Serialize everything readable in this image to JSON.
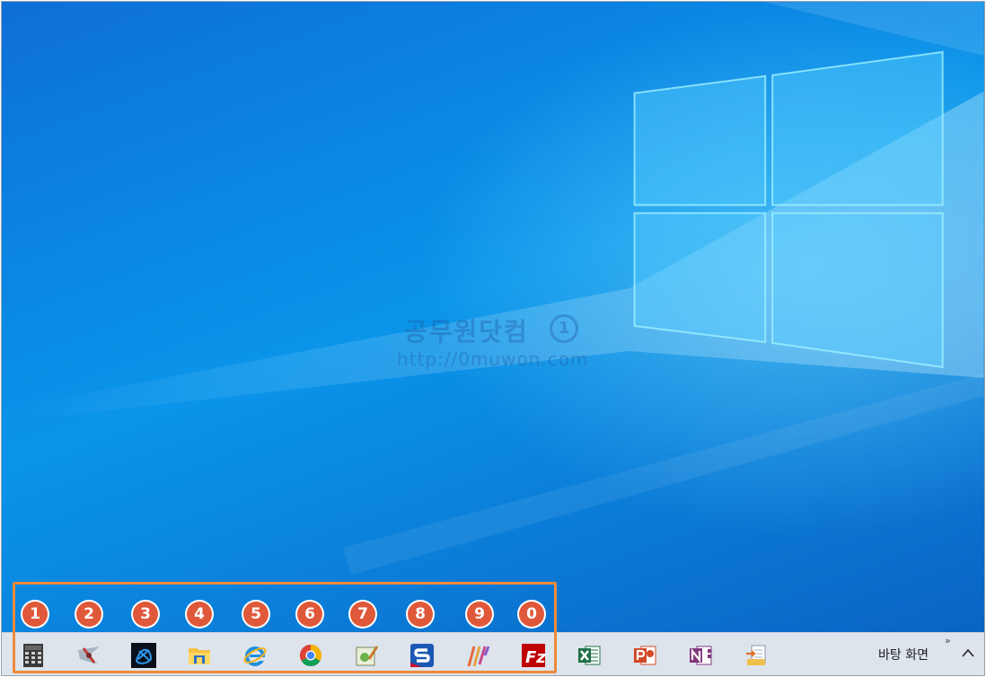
{
  "watermark": {
    "title": "공무원닷컴",
    "badge": "1",
    "url": "http://0muwon.com"
  },
  "badges": [
    "1",
    "2",
    "3",
    "4",
    "5",
    "6",
    "7",
    "8",
    "9",
    "0"
  ],
  "taskbar": {
    "apps": [
      {
        "name": "calculator-icon"
      },
      {
        "name": "alzip-icon"
      },
      {
        "name": "battle-net-icon"
      },
      {
        "name": "file-explorer-icon"
      },
      {
        "name": "internet-explorer-icon"
      },
      {
        "name": "chrome-icon"
      },
      {
        "name": "notepad-icon"
      },
      {
        "name": "snagit-icon"
      },
      {
        "name": "vellum-icon"
      },
      {
        "name": "filezilla-icon"
      },
      {
        "name": "excel-icon"
      },
      {
        "name": "powerpoint-icon"
      },
      {
        "name": "onenote-icon"
      },
      {
        "name": "file-transfer-icon"
      }
    ],
    "show_desktop_label": "바탕 화면",
    "overflow_indicator": "»",
    "chevron_up": "^"
  },
  "colors": {
    "highlight": "#ee8a3c",
    "badge": "#e0583a",
    "taskbar": "#dde4ec",
    "desktop_accent": "#0a95ea"
  }
}
